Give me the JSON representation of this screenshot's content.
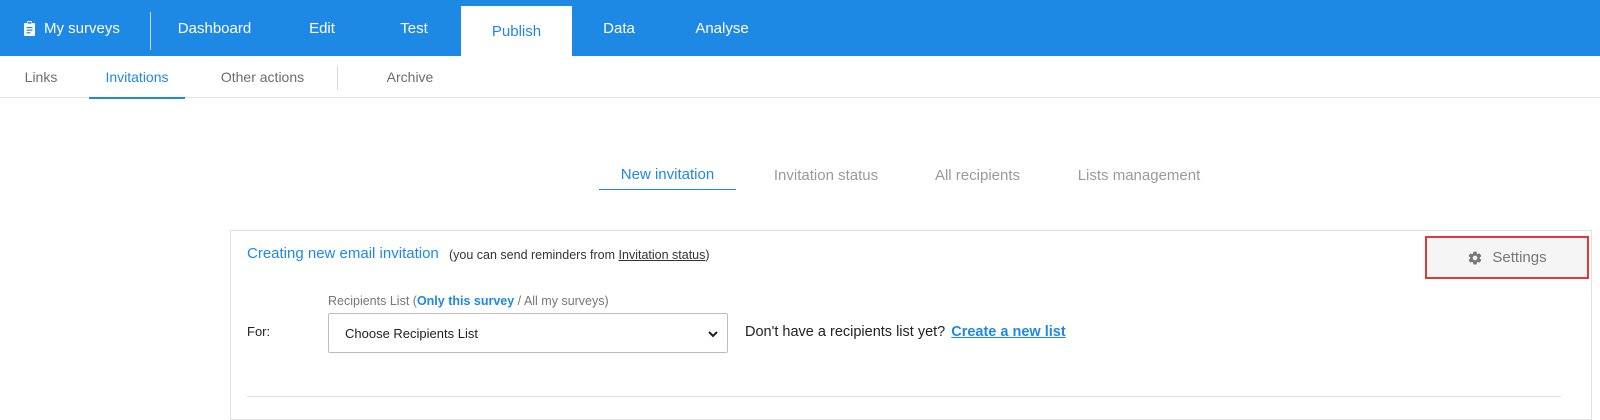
{
  "topnav": {
    "brand": "My surveys",
    "tabs": [
      {
        "label": "Dashboard"
      },
      {
        "label": "Edit"
      },
      {
        "label": "Test"
      },
      {
        "label": "Publish",
        "active": true
      },
      {
        "label": "Data"
      },
      {
        "label": "Analyse"
      }
    ]
  },
  "subnav": {
    "tabs": [
      {
        "label": "Links"
      },
      {
        "label": "Invitations",
        "active": true
      },
      {
        "label": "Other actions"
      },
      {
        "label": "Archive"
      }
    ]
  },
  "inner_tabs": [
    {
      "label": "New invitation",
      "active": true
    },
    {
      "label": "Invitation status"
    },
    {
      "label": "All recipients"
    },
    {
      "label": "Lists management"
    }
  ],
  "panel": {
    "title": "Creating new email invitation",
    "note_prefix": "(you can send reminders from",
    "note_link": "Invitation status",
    "note_suffix": ")",
    "settings_label": "Settings",
    "recipients_label_prefix": "Recipients List (",
    "recipients_only_this": "Only this survey",
    "recipients_sep": " / ",
    "recipients_all": "All my surveys",
    "recipients_suffix": ")",
    "for_label": "For:",
    "select_value": "Choose Recipients List",
    "no_list_text": "Don't have a recipients list yet?",
    "create_list_link": "Create a new list"
  },
  "colors": {
    "primary": "#1e88e5",
    "highlight_border": "#e53935"
  }
}
